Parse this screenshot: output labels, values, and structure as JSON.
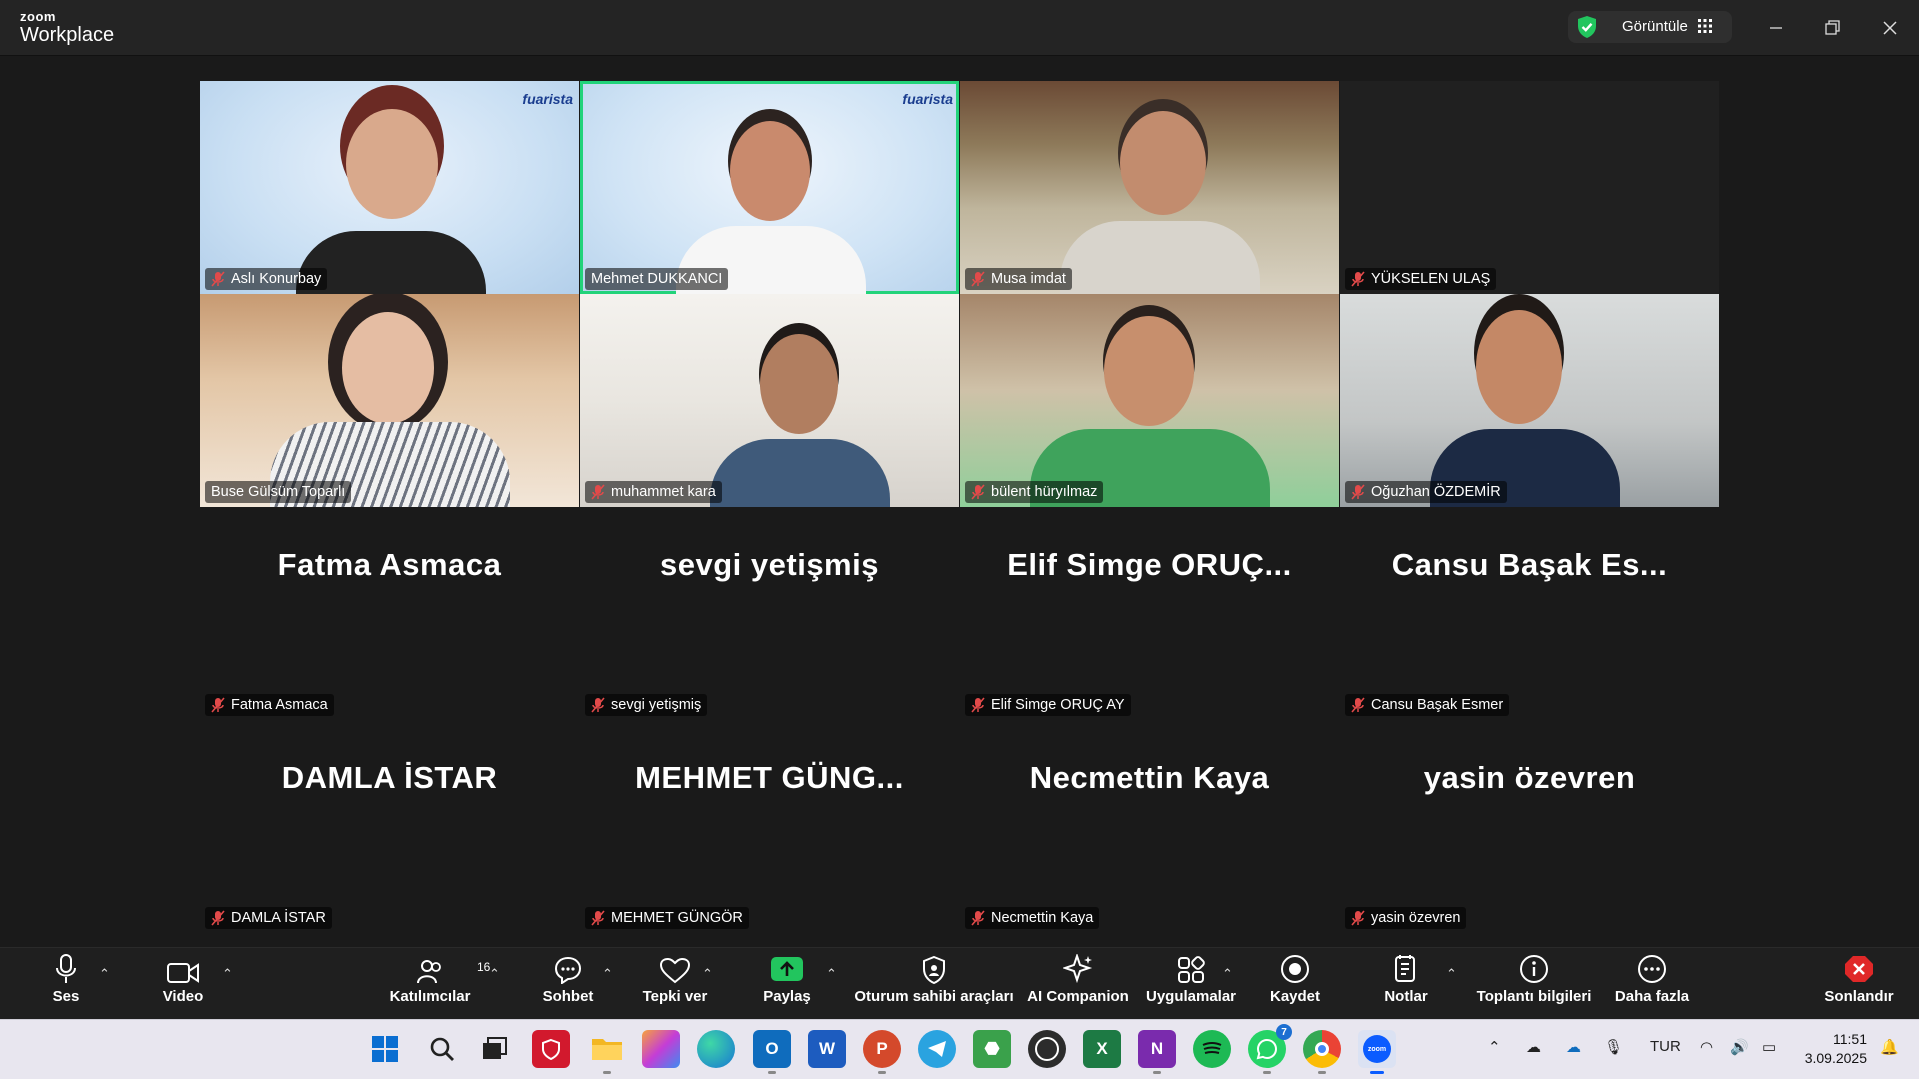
{
  "app": {
    "brand_small": "zoom",
    "brand_large": "Workplace",
    "view_label": "Görüntüle"
  },
  "colors": {
    "active_speaker": "#22d37a",
    "toolbar_bg": "#1f1f1f",
    "end_red": "#e02828",
    "share_green": "#22c55e"
  },
  "video_tiles": [
    {
      "name": "Aslı Konurbay",
      "muted": true,
      "logo": "fuarista"
    },
    {
      "name": "Mehmet DUKKANCI",
      "muted": false,
      "logo": "fuarista",
      "active": true
    },
    {
      "name": "Musa imdat",
      "muted": true
    },
    {
      "name": "YÜKSELEN ULAŞ",
      "muted": true
    },
    {
      "name": "Buse Gülsüm Toparlı",
      "muted": false
    },
    {
      "name": "muhammet kara",
      "muted": true
    },
    {
      "name": "bülent hüryılmaz",
      "muted": true
    },
    {
      "name": "Oğuzhan ÖZDEMİR",
      "muted": true
    }
  ],
  "name_tiles": [
    {
      "display": "Fatma Asmaca",
      "name": "Fatma Asmaca"
    },
    {
      "display": "sevgi yetişmiş",
      "name": "sevgi yetişmiş"
    },
    {
      "display": "Elif Simge ORUÇ...",
      "name": "Elif Simge ORUÇ AY"
    },
    {
      "display": "Cansu Başak Es...",
      "name": "Cansu Başak Esmer"
    },
    {
      "display": "DAMLA İSTAR",
      "name": "DAMLA İSTAR"
    },
    {
      "display": "MEHMET GÜNG...",
      "name": "MEHMET GÜNGÖR"
    },
    {
      "display": "Necmettin Kaya",
      "name": "Necmettin Kaya"
    },
    {
      "display": "yasin özevren",
      "name": "yasin özevren"
    }
  ],
  "toolbar": {
    "audio": "Ses",
    "video": "Video",
    "participants": "Katılımcılar",
    "participants_count": "16",
    "chat": "Sohbet",
    "react": "Tepki ver",
    "share": "Paylaş",
    "host_tools": "Oturum sahibi araçları",
    "ai": "AI Companion",
    "apps": "Uygulamalar",
    "record": "Kaydet",
    "notes": "Notlar",
    "info": "Toplantı bilgileri",
    "more": "Daha fazla",
    "end": "Sonlandır"
  },
  "taskbar": {
    "whatsapp_badge": "7",
    "language": "TUR",
    "time": "11:51",
    "date": "3.09.2025",
    "apps": [
      "start-icon",
      "search-icon",
      "task-view-icon",
      "vpn-icon",
      "file-explorer-icon",
      "copilot-icon",
      "edge-icon",
      "outlook-icon",
      "word-icon",
      "powerpoint-icon",
      "telegram-icon",
      "android-icon",
      "obs-icon",
      "excel-icon",
      "onenote-icon",
      "spotify-icon",
      "whatsapp-icon",
      "chrome-icon",
      "zoom-icon"
    ]
  }
}
